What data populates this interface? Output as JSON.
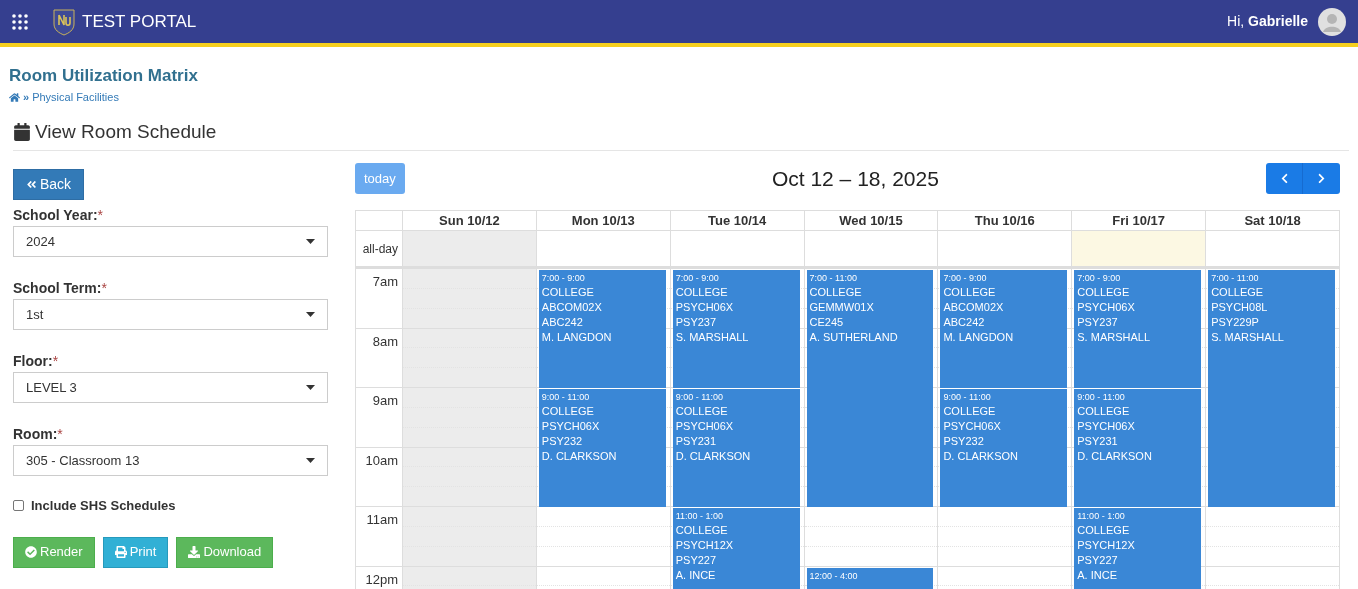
{
  "header": {
    "title": "TEST PORTAL",
    "greeting": "Hi,",
    "user": "Gabrielle"
  },
  "page": {
    "title": "Room Utilization Matrix",
    "breadcrumb": [
      {
        "separator": "»",
        "label": "Physical Facilities"
      }
    ],
    "section_title": "View Room Schedule"
  },
  "filters": {
    "back_button": "Back",
    "fields": [
      {
        "label": "School Year:",
        "required_mark": "*",
        "value": "2024"
      },
      {
        "label": "School Term:",
        "required_mark": "*",
        "value": "1st"
      },
      {
        "label": "Floor:",
        "required_mark": "*",
        "value": "LEVEL 3"
      },
      {
        "label": "Room:",
        "required_mark": "*",
        "value": "305 - Classroom 13"
      }
    ],
    "checkbox": {
      "label": "Include SHS Schedules",
      "checked": false
    },
    "buttons": [
      {
        "kind": "render",
        "label": "Render"
      },
      {
        "kind": "print",
        "label": "Print"
      },
      {
        "kind": "download",
        "label": "Download"
      }
    ]
  },
  "calendar": {
    "today_button": "today",
    "range_title": "Oct 12 – 18, 2025",
    "allday_label": "all-day",
    "hours": [
      "7am",
      "8am",
      "9am",
      "10am",
      "11am",
      "12pm"
    ],
    "days": [
      {
        "label": "Sun 10/12",
        "shaded": true,
        "today": false
      },
      {
        "label": "Mon 10/13",
        "shaded": false,
        "today": false,
        "events": [
          {
            "time": "7:00 - 9:00",
            "lines": [
              "COLLEGE",
              "ABCOM02X",
              "ABC242",
              "M. LANGDON"
            ]
          },
          {
            "time": "9:00 - 11:00",
            "lines": [
              "COLLEGE",
              "PSYCH06X",
              "PSY232",
              "D. CLARKSON"
            ]
          }
        ]
      },
      {
        "label": "Tue 10/14",
        "shaded": false,
        "today": false,
        "events": [
          {
            "time": "7:00 - 9:00",
            "lines": [
              "COLLEGE",
              "PSYCH06X",
              "PSY237",
              "S. MARSHALL"
            ]
          },
          {
            "time": "9:00 - 11:00",
            "lines": [
              "COLLEGE",
              "PSYCH06X",
              "PSY231",
              "D. CLARKSON"
            ]
          },
          {
            "time": "11:00 - 1:00",
            "lines": [
              "COLLEGE",
              "PSYCH12X",
              "PSY227",
              "A. INCE"
            ]
          }
        ]
      },
      {
        "label": "Wed 10/15",
        "shaded": false,
        "today": false,
        "events": [
          {
            "time": "7:00 - 11:00",
            "lines": [
              "COLLEGE",
              "GEMMW01X",
              "CE245",
              "A. SUTHERLAND"
            ]
          },
          {
            "time": "12:00 - 4:00"
          }
        ]
      },
      {
        "label": "Thu 10/16",
        "shaded": false,
        "today": false,
        "events": [
          {
            "time": "7:00 - 9:00",
            "lines": [
              "COLLEGE",
              "ABCOM02X",
              "ABC242",
              "M. LANGDON"
            ]
          },
          {
            "time": "9:00 - 11:00",
            "lines": [
              "COLLEGE",
              "PSYCH06X",
              "PSY232",
              "D. CLARKSON"
            ]
          }
        ]
      },
      {
        "label": "Fri 10/17",
        "shaded": false,
        "today": true,
        "events": [
          {
            "time": "7:00 - 9:00",
            "lines": [
              "COLLEGE",
              "PSYCH06X",
              "PSY237",
              "S. MARSHALL"
            ]
          },
          {
            "time": "9:00 - 11:00",
            "lines": [
              "COLLEGE",
              "PSYCH06X",
              "PSY231",
              "D. CLARKSON"
            ]
          },
          {
            "time": "11:00 - 1:00",
            "lines": [
              "COLLEGE",
              "PSYCH12X",
              "PSY227",
              "A. INCE"
            ]
          }
        ]
      },
      {
        "label": "Sat 10/18",
        "shaded": false,
        "today": false,
        "events": [
          {
            "time": "7:00 - 11:00",
            "lines": [
              "COLLEGE",
              "PSYCH08L",
              "PSY229P",
              "S. MARSHALL"
            ]
          }
        ]
      }
    ]
  }
}
